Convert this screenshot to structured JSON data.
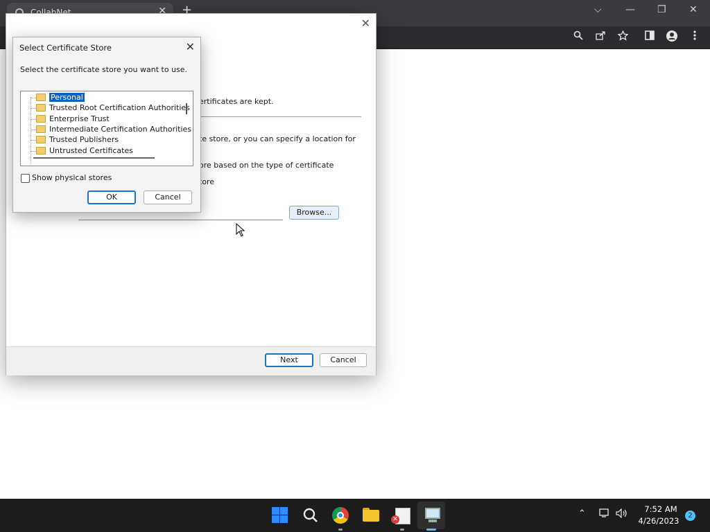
{
  "browser": {
    "tab_title": "CollabNet",
    "tab_close": "✕",
    "new_tab": "+",
    "window_controls": {
      "chevron": "⌵",
      "minimize": "—",
      "restore": "❐",
      "close": "✕"
    },
    "toolbar_icons": [
      "search-icon",
      "share-icon",
      "star-icon",
      "sidepanel-icon",
      "profile-icon",
      "menu-icon"
    ]
  },
  "wizard": {
    "close": "✕",
    "fragment_kept": "ertificates are kept.",
    "fragment_store_specify": "te store, or you can specify a location for",
    "fragment_auto": "ore based on the type of certificate",
    "fragment_place": "tore",
    "browse_label": "Browse...",
    "next_label": "Next",
    "cancel_label": "Cancel"
  },
  "dialog": {
    "title": "Select Certificate Store",
    "close": "✕",
    "prompt": "Select the certificate store you want to use.",
    "stores": [
      "Personal",
      "Trusted Root Certification Authorities",
      "Enterprise Trust",
      "Intermediate Certification Authorities",
      "Trusted Publishers",
      "Untrusted Certificates"
    ],
    "selected_store": "Personal",
    "show_physical_label": "Show physical stores",
    "show_physical_checked": false,
    "ok_label": "OK",
    "cancel_label": "Cancel"
  },
  "taskbar": {
    "apps": [
      "windows-start",
      "search",
      "chrome",
      "file-explorer",
      "certificate-manager",
      "certificate-import-wizard"
    ],
    "active_app": "certificate-import-wizard",
    "tray_chevron": "⌃",
    "time": "7:52 AM",
    "date": "4/26/2023",
    "notification_count": "2"
  },
  "colors": {
    "accent": "#1a73c8",
    "selection": "#0a64c8",
    "taskbar": "#1c1c1c",
    "chrome_frame": "#3a3b3e"
  }
}
